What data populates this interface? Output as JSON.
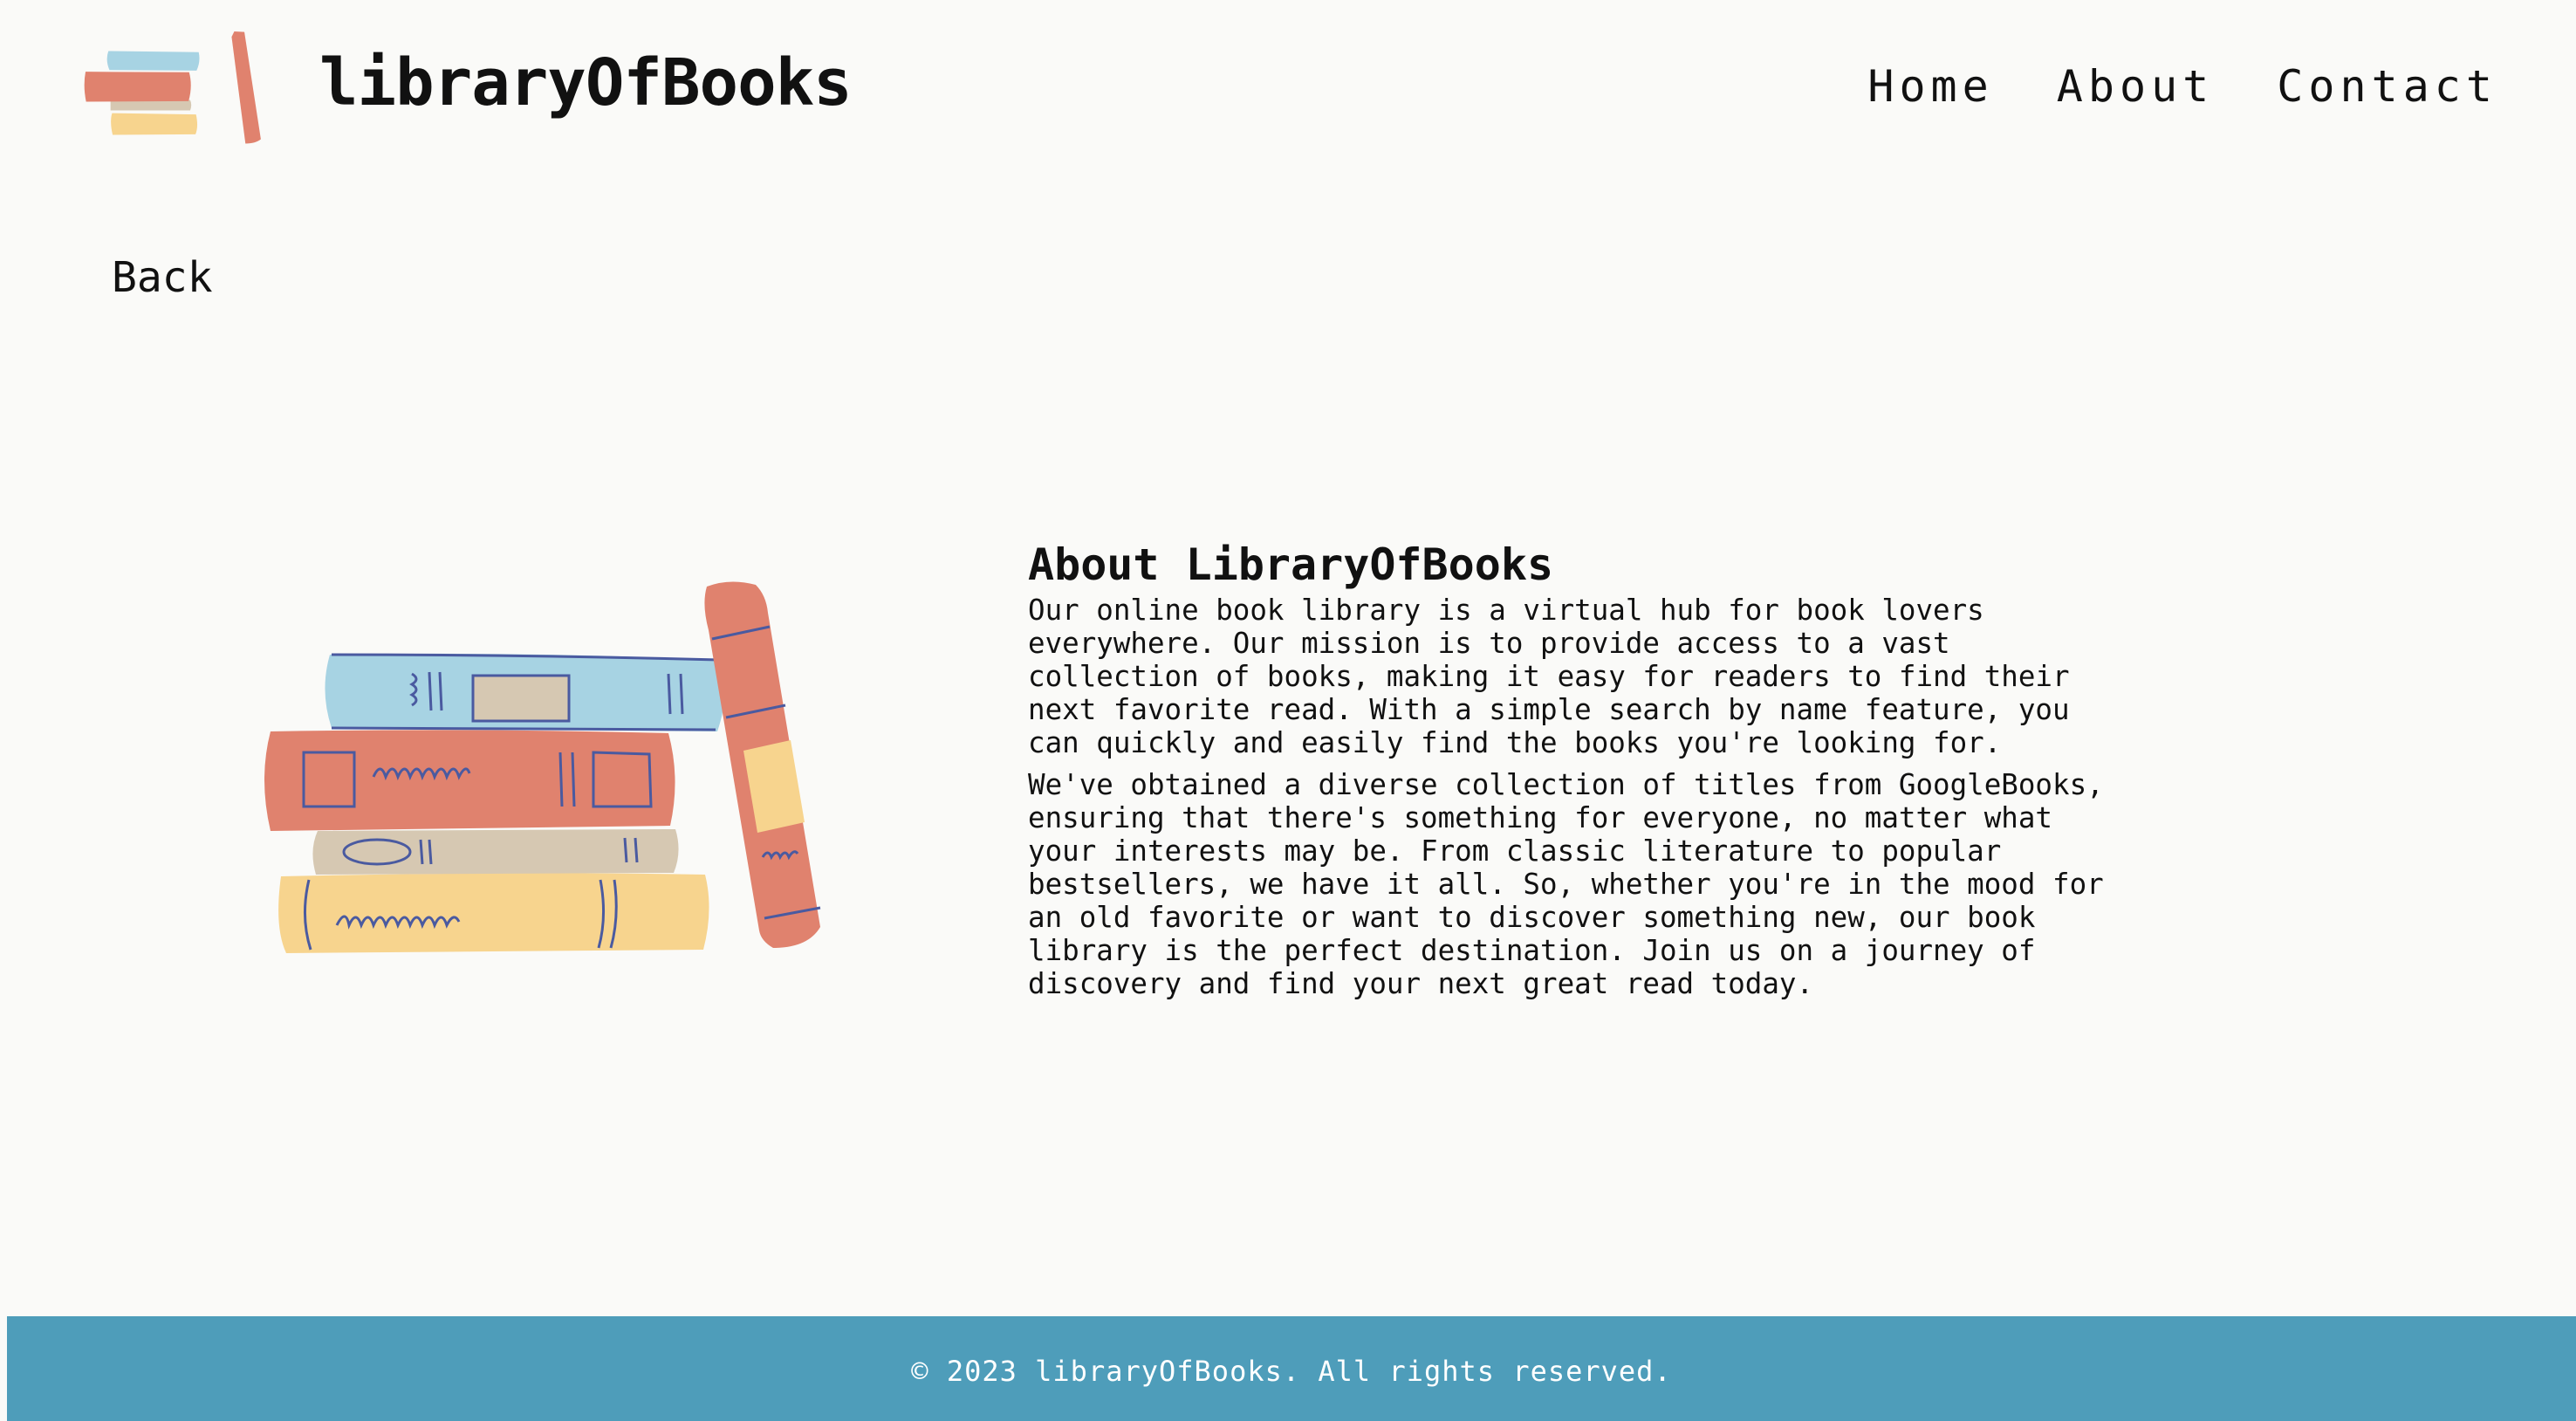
{
  "header": {
    "brand": "libraryOfBooks",
    "logo_icon": "books-stack-icon",
    "nav": [
      {
        "label": "Home"
      },
      {
        "label": "About"
      },
      {
        "label": "Contact"
      }
    ]
  },
  "back_link": "Back",
  "hero": {
    "icon": "books-stack-illustration"
  },
  "about": {
    "title": "About LibraryOfBooks",
    "paragraphs": [
      "Our online book library is a virtual hub for book lovers everywhere. Our mission is to provide access to a vast collection of books, making it easy for readers to find their next favorite read. With a simple search by name feature, you can quickly and easily find the books you're looking for.",
      "We've obtained a diverse collection of titles from GoogleBooks, ensuring that there's something for everyone, no matter what your interests may be. From classic literature to popular bestsellers, we have it all. So, whether you're in the mood for an old favorite or want to discover something new, our book library is the perfect destination. Join us on a journey of discovery and find your next great read today."
    ]
  },
  "footer": {
    "text": "© 2023 libraryOfBooks. All rights reserved."
  },
  "colors": {
    "background": "#fafaf8",
    "footer": "#4e9dba",
    "book_blue": "#a7d3e3",
    "book_red": "#e0826e",
    "book_beige": "#d6c8b2",
    "book_yellow": "#f7d48e",
    "ink": "#4a5aa0"
  }
}
